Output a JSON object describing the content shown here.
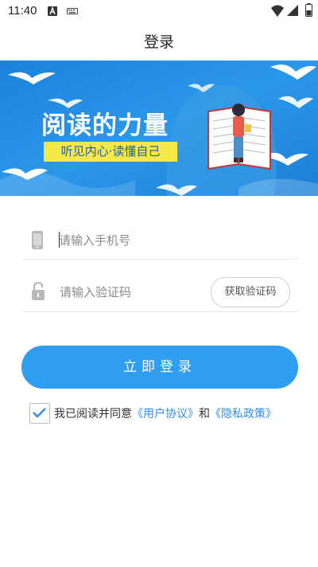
{
  "status_bar": {
    "time": "11:40",
    "icons": [
      "font-a-icon",
      "keyboard-icon",
      "wifi-icon",
      "signal-icon",
      "battery-icon"
    ]
  },
  "header": {
    "title": "登录"
  },
  "banner": {
    "title": "阅读的力量",
    "slogan": "听见内心·读懂自己",
    "colors": {
      "background": "#2a8fe0",
      "slogan_bg": "#f5e94a",
      "slogan_text": "#1f5fa8"
    }
  },
  "form": {
    "phone": {
      "placeholder": "请输入手机号",
      "value": "",
      "icon": "phone-icon"
    },
    "code": {
      "placeholder": "请输入验证码",
      "value": "",
      "icon": "lock-icon"
    },
    "get_code_label": "获取验证码"
  },
  "login": {
    "label": "立即登录",
    "color": "#2f9ef0"
  },
  "agreement": {
    "checked": true,
    "prefix": "我已阅读并同意",
    "user_agreement": "《用户协议》",
    "conjunction": "和",
    "privacy_policy": "《隐私政策》",
    "link_color": "#2f8ff0"
  }
}
